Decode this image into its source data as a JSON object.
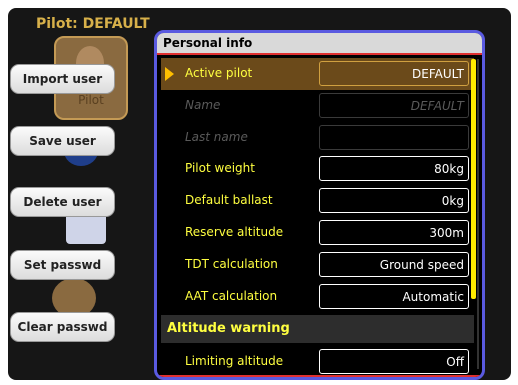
{
  "header": {
    "pilot_label": "Pilot: DEFAULT"
  },
  "pilot_icon": {
    "label": "Pilot"
  },
  "side_buttons": {
    "import": "Import user",
    "save": "Save user",
    "delete": "Delete user",
    "set_passwd": "Set passwd",
    "clear_passwd": "Clear passwd"
  },
  "dialog": {
    "title": "Personal info",
    "rows": [
      {
        "label": "Active pilot",
        "value": "DEFAULT",
        "enabled": true,
        "active": true
      },
      {
        "label": "Name",
        "value": "DEFAULT",
        "enabled": false
      },
      {
        "label": "Last name",
        "value": "",
        "enabled": false
      },
      {
        "label": "Pilot weight",
        "value": "80kg",
        "enabled": true
      },
      {
        "label": "Default ballast",
        "value": "0kg",
        "enabled": true
      },
      {
        "label": "Reserve altitude",
        "value": "300m",
        "enabled": true
      },
      {
        "label": "TDT calculation",
        "value": "Ground speed",
        "enabled": true
      },
      {
        "label": "AAT calculation",
        "value": "Automatic",
        "enabled": true
      }
    ],
    "section_title": "Altitude warning",
    "section_rows": [
      {
        "label": "Limiting altitude",
        "value": "Off",
        "enabled": true
      }
    ]
  },
  "colors": {
    "accent_yellow": "#ffff40",
    "active_bg": "#6b4a1a",
    "dialog_border": "#5a5ae0",
    "scrollbar": "#ffea00"
  }
}
